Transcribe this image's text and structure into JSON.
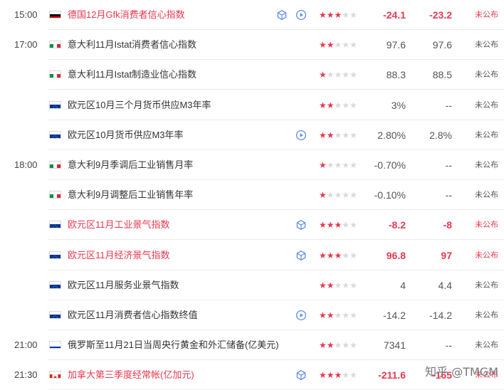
{
  "colors": {
    "accent": "#e8384f",
    "star_off": "#d9d9d9"
  },
  "events": [
    {
      "time": "15:00",
      "flag": "germany",
      "name": "德国12月Gfk消费者信心指数",
      "highlight": true,
      "icons": [
        "cube-icon",
        "play-icon"
      ],
      "stars": 3,
      "forecast": "-24.1",
      "previous": "-23.2",
      "status": "未公布"
    },
    {
      "time": "17:00",
      "flag": "italy",
      "name": "意大利11月Istat消费者信心指数",
      "highlight": false,
      "icons": [],
      "stars": 2,
      "forecast": "97.6",
      "previous": "97.6",
      "status": "未公布"
    },
    {
      "time": "",
      "flag": "italy",
      "name": "意大利11月Istat制造业信心指数",
      "highlight": false,
      "icons": [],
      "stars": 1,
      "forecast": "88.3",
      "previous": "88.5",
      "status": "未公布"
    },
    {
      "time": "",
      "flag": "eu",
      "name": "欧元区10月三个月货币供应M3年率",
      "highlight": false,
      "icons": [],
      "stars": 2,
      "forecast": "3%",
      "previous": "--",
      "status": "未公布"
    },
    {
      "time": "",
      "flag": "eu",
      "name": "欧元区10月货币供应M3年率",
      "highlight": false,
      "icons": [
        "play-icon"
      ],
      "stars": 2,
      "forecast": "2.80%",
      "previous": "2.8%",
      "status": "未公布"
    },
    {
      "time": "18:00",
      "flag": "italy",
      "name": "意大利9月季调后工业销售月率",
      "highlight": false,
      "icons": [],
      "stars": 1,
      "forecast": "-0.70%",
      "previous": "--",
      "status": "未公布"
    },
    {
      "time": "",
      "flag": "italy",
      "name": "意大利9月调整后工业销售年率",
      "highlight": false,
      "icons": [],
      "stars": 1,
      "forecast": "-0.10%",
      "previous": "--",
      "status": "未公布"
    },
    {
      "time": "",
      "flag": "eu",
      "name": "欧元区11月工业景气指数",
      "highlight": true,
      "icons": [
        "cube-icon"
      ],
      "stars": 3,
      "forecast": "-8.2",
      "previous": "-8",
      "status": "未公布"
    },
    {
      "time": "",
      "flag": "eu",
      "name": "欧元区11月经济景气指数",
      "highlight": true,
      "icons": [
        "cube-icon"
      ],
      "stars": 3,
      "forecast": "96.8",
      "previous": "97",
      "status": "未公布"
    },
    {
      "time": "",
      "flag": "eu",
      "name": "欧元区11月服务业景气指数",
      "highlight": false,
      "icons": [],
      "stars": 2,
      "forecast": "4",
      "previous": "4.4",
      "status": "未公布"
    },
    {
      "time": "",
      "flag": "eu",
      "name": "欧元区11月消费者信心指数终值",
      "highlight": false,
      "icons": [
        "play-icon"
      ],
      "stars": 2,
      "forecast": "-14.2",
      "previous": "-14.2",
      "status": "未公布"
    },
    {
      "time": "21:00",
      "flag": "russia",
      "name": "俄罗斯至11月21日当周央行黄金和外汇储备(亿美元)",
      "highlight": false,
      "icons": [],
      "stars": 2,
      "forecast": "7341",
      "previous": "--",
      "status": "未公布"
    },
    {
      "time": "21:30",
      "flag": "canada",
      "name": "加拿大第三季度经常帐(亿加元)",
      "highlight": true,
      "icons": [
        "cube-icon"
      ],
      "stars": 3,
      "forecast": "-211.6",
      "previous": "-165",
      "status": "未公布"
    }
  ],
  "watermark": "知乎 @TMGM"
}
